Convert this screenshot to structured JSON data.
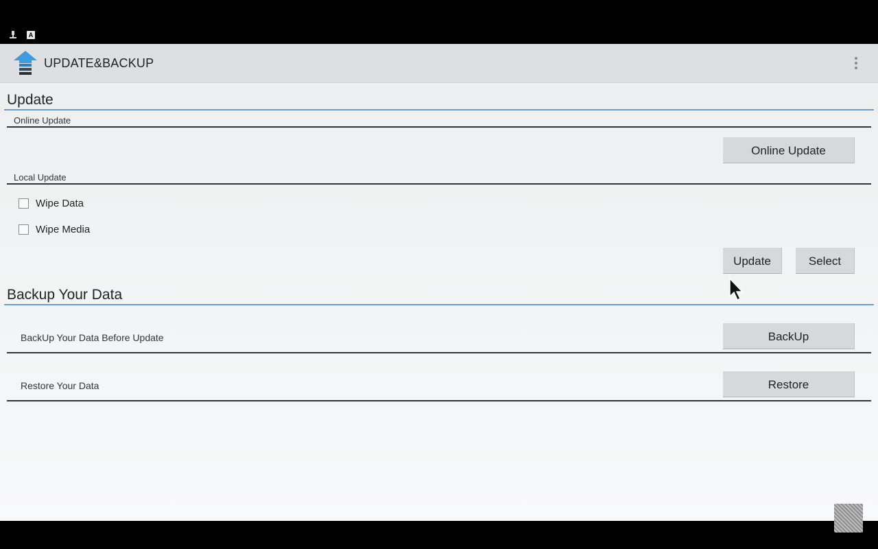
{
  "statusbar": {
    "icons": [
      "usb-debug-icon",
      "keyboard-icon"
    ],
    "keyboard_glyph": "A"
  },
  "app": {
    "title": "UPDATE&BACKUP",
    "logo_icon": "update-backup-app-icon",
    "overflow_icon": "overflow-menu-icon"
  },
  "update": {
    "title": "Update",
    "online": {
      "label": "Online Update",
      "button": "Online Update"
    },
    "local": {
      "label": "Local Update",
      "checkboxes": [
        {
          "label": "Wipe Data",
          "checked": false
        },
        {
          "label": "Wipe Media",
          "checked": false
        }
      ],
      "update_button": "Update",
      "select_button": "Select"
    }
  },
  "backup": {
    "title": "Backup Your Data",
    "rows": [
      {
        "label": "BackUp Your Data Before Update",
        "button": "BackUp"
      },
      {
        "label": "Restore Your Data",
        "button": "Restore"
      }
    ]
  },
  "colors": {
    "accent": "#6a9cd6",
    "background": "#eceeef",
    "actionbar": "#dddfe1",
    "button": "#d6d8da"
  }
}
